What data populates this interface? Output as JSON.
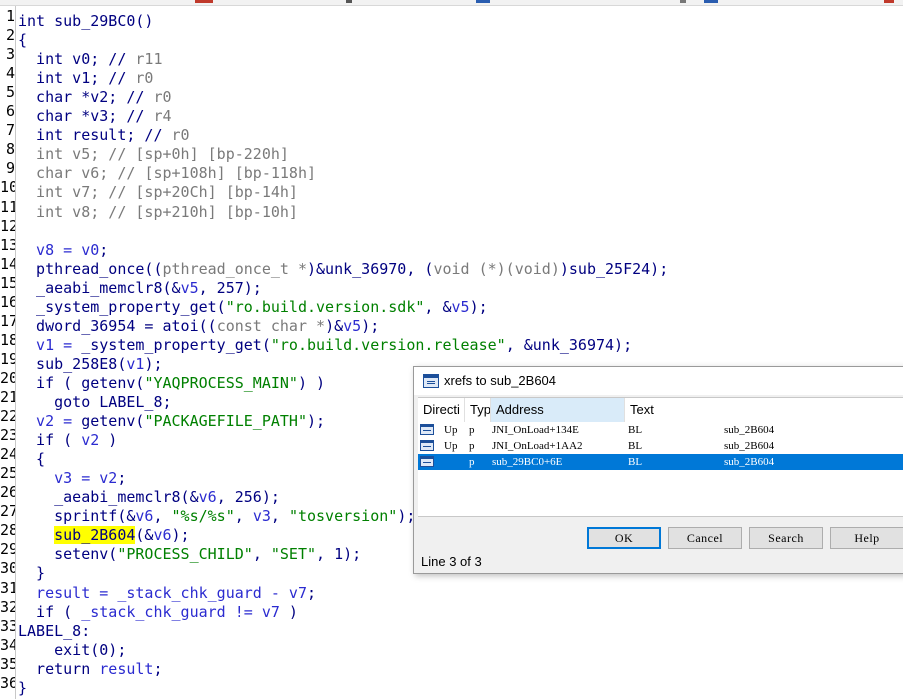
{
  "colors": {
    "selection": "#0078d7",
    "highlight": "#ffff00",
    "keyword": "#000080",
    "variable": "#2b2bd0",
    "comment": "#7a7a7a",
    "string": "#008000"
  },
  "code_lines": [
    {
      "n": "1",
      "tokens": [
        {
          "t": "int sub_29BC0()",
          "c": "kw"
        }
      ]
    },
    {
      "n": "2",
      "tokens": [
        {
          "t": "{",
          "c": "kw"
        }
      ]
    },
    {
      "n": "3",
      "tokens": [
        {
          "t": "  int v0; // ",
          "c": "kw"
        },
        {
          "t": "r11",
          "c": "cmt"
        }
      ]
    },
    {
      "n": "4",
      "tokens": [
        {
          "t": "  int v1; // ",
          "c": "kw"
        },
        {
          "t": "r0",
          "c": "cmt"
        }
      ]
    },
    {
      "n": "5",
      "tokens": [
        {
          "t": "  char *v2; // ",
          "c": "kw"
        },
        {
          "t": "r0",
          "c": "cmt"
        }
      ]
    },
    {
      "n": "6",
      "tokens": [
        {
          "t": "  char *v3; // ",
          "c": "kw"
        },
        {
          "t": "r4",
          "c": "cmt"
        }
      ]
    },
    {
      "n": "7",
      "tokens": [
        {
          "t": "  int result; // ",
          "c": "kw"
        },
        {
          "t": "r0",
          "c": "cmt"
        }
      ]
    },
    {
      "n": "8",
      "tokens": [
        {
          "t": "  int v5; // ",
          "c": "cmt"
        },
        {
          "t": "[sp+0h] [bp-220h]",
          "c": "cmt"
        }
      ]
    },
    {
      "n": "9",
      "tokens": [
        {
          "t": "  char v6; // ",
          "c": "cmt"
        },
        {
          "t": "[sp+108h] [bp-118h]",
          "c": "cmt"
        }
      ]
    },
    {
      "n": "10",
      "tokens": [
        {
          "t": "  int v7; // ",
          "c": "cmt"
        },
        {
          "t": "[sp+20Ch] [bp-14h]",
          "c": "cmt"
        }
      ]
    },
    {
      "n": "11",
      "tokens": [
        {
          "t": "  int v8; // ",
          "c": "cmt"
        },
        {
          "t": "[sp+210h] [bp-10h]",
          "c": "cmt"
        }
      ]
    },
    {
      "n": "12",
      "tokens": []
    },
    {
      "n": "13",
      "tokens": [
        {
          "t": "  v8 = ",
          "c": "var"
        },
        {
          "t": "v0",
          "c": "var"
        },
        {
          "t": ";",
          "c": "kw"
        }
      ]
    },
    {
      "n": "14",
      "tokens": [
        {
          "t": "  pthread_once((",
          "c": "fn"
        },
        {
          "t": "pthread_once_t *",
          "c": "cmt"
        },
        {
          "t": ")&unk_36970, (",
          "c": "fn"
        },
        {
          "t": "void (*)(void)",
          "c": "cmt"
        },
        {
          "t": ")sub_25F24);",
          "c": "fn"
        }
      ]
    },
    {
      "n": "15",
      "tokens": [
        {
          "t": "  _aeabi_memclr8(&",
          "c": "fn"
        },
        {
          "t": "v5",
          "c": "var"
        },
        {
          "t": ", 257);",
          "c": "fn"
        }
      ]
    },
    {
      "n": "16",
      "tokens": [
        {
          "t": "  _system_property_get(",
          "c": "fn"
        },
        {
          "t": "\"ro.build.version.sdk\"",
          "c": "str"
        },
        {
          "t": ", &",
          "c": "fn"
        },
        {
          "t": "v5",
          "c": "var"
        },
        {
          "t": ");",
          "c": "fn"
        }
      ]
    },
    {
      "n": "17",
      "tokens": [
        {
          "t": "  dword_36954 = atoi((",
          "c": "fn"
        },
        {
          "t": "const char *",
          "c": "cmt"
        },
        {
          "t": ")&",
          "c": "fn"
        },
        {
          "t": "v5",
          "c": "var"
        },
        {
          "t": ");",
          "c": "fn"
        }
      ]
    },
    {
      "n": "18",
      "tokens": [
        {
          "t": "  v1 = ",
          "c": "var"
        },
        {
          "t": "_system_property_get(",
          "c": "fn"
        },
        {
          "t": "\"ro.build.version.release\"",
          "c": "str"
        },
        {
          "t": ", &unk_36974);",
          "c": "fn"
        }
      ]
    },
    {
      "n": "19",
      "tokens": [
        {
          "t": "  sub_258E8(",
          "c": "fn"
        },
        {
          "t": "v1",
          "c": "var"
        },
        {
          "t": ");",
          "c": "fn"
        }
      ]
    },
    {
      "n": "20",
      "tokens": [
        {
          "t": "  if ( getenv(",
          "c": "kw"
        },
        {
          "t": "\"YAQPROCESS_MAIN\"",
          "c": "str"
        },
        {
          "t": ") )",
          "c": "kw"
        }
      ]
    },
    {
      "n": "21",
      "tokens": [
        {
          "t": "    goto LABEL_8;",
          "c": "kw"
        }
      ]
    },
    {
      "n": "22",
      "tokens": [
        {
          "t": "  v2 = ",
          "c": "var"
        },
        {
          "t": "getenv(",
          "c": "fn"
        },
        {
          "t": "\"PACKAGEFILE_PATH\"",
          "c": "str"
        },
        {
          "t": ");",
          "c": "fn"
        }
      ]
    },
    {
      "n": "23",
      "tokens": [
        {
          "t": "  if ( ",
          "c": "kw"
        },
        {
          "t": "v2",
          "c": "var"
        },
        {
          "t": " )",
          "c": "kw"
        }
      ]
    },
    {
      "n": "24",
      "tokens": [
        {
          "t": "  {",
          "c": "kw"
        }
      ]
    },
    {
      "n": "25",
      "tokens": [
        {
          "t": "    v3 = v2",
          "c": "var"
        },
        {
          "t": ";",
          "c": "kw"
        }
      ]
    },
    {
      "n": "26",
      "tokens": [
        {
          "t": "    _aeabi_memclr8(&",
          "c": "fn"
        },
        {
          "t": "v6",
          "c": "var"
        },
        {
          "t": ", 256);",
          "c": "fn"
        }
      ]
    },
    {
      "n": "27",
      "tokens": [
        {
          "t": "    sprintf(&",
          "c": "fn"
        },
        {
          "t": "v6",
          "c": "var"
        },
        {
          "t": ", ",
          "c": "fn"
        },
        {
          "t": "\"%s/%s\"",
          "c": "str"
        },
        {
          "t": ", ",
          "c": "fn"
        },
        {
          "t": "v3",
          "c": "var"
        },
        {
          "t": ", ",
          "c": "fn"
        },
        {
          "t": "\"tosversion\"",
          "c": "str"
        },
        {
          "t": ");",
          "c": "fn"
        }
      ]
    },
    {
      "n": "28",
      "tokens": [
        {
          "t": "    ",
          "c": "kw"
        },
        {
          "t": "sub_2B604",
          "c": "hl"
        },
        {
          "t": "(&",
          "c": "fn"
        },
        {
          "t": "v6",
          "c": "var"
        },
        {
          "t": ");",
          "c": "fn"
        }
      ]
    },
    {
      "n": "29",
      "tokens": [
        {
          "t": "    setenv(",
          "c": "fn"
        },
        {
          "t": "\"PROCESS_CHILD\"",
          "c": "str"
        },
        {
          "t": ", ",
          "c": "fn"
        },
        {
          "t": "\"SET\"",
          "c": "str"
        },
        {
          "t": ", 1);",
          "c": "fn"
        }
      ]
    },
    {
      "n": "30",
      "tokens": [
        {
          "t": "  }",
          "c": "kw"
        }
      ]
    },
    {
      "n": "31",
      "tokens": [
        {
          "t": "  result = _stack_chk_guard - v7",
          "c": "var"
        },
        {
          "t": ";",
          "c": "kw"
        }
      ]
    },
    {
      "n": "32",
      "tokens": [
        {
          "t": "  if ( ",
          "c": "kw"
        },
        {
          "t": "_stack_chk_guard != v7",
          "c": "var"
        },
        {
          "t": " )",
          "c": "kw"
        }
      ]
    },
    {
      "n": "33",
      "tokens": [
        {
          "t": "LABEL_8:",
          "c": "kw"
        }
      ]
    },
    {
      "n": "34",
      "tokens": [
        {
          "t": "    exit(0);",
          "c": "fn"
        }
      ]
    },
    {
      "n": "35",
      "tokens": [
        {
          "t": "  return ",
          "c": "kw"
        },
        {
          "t": "result",
          "c": "var"
        },
        {
          "t": ";",
          "c": "kw"
        }
      ]
    },
    {
      "n": "36",
      "tokens": [
        {
          "t": "}",
          "c": "kw"
        }
      ]
    }
  ],
  "dialog": {
    "title": "xrefs to sub_2B604",
    "columns": [
      "Directi",
      "Typ",
      "Address",
      "Text"
    ],
    "rows": [
      {
        "direction": "Up",
        "type": "p",
        "address": "JNI_OnLoad+134E",
        "text": "BL",
        "target": "sub_2B604",
        "selected": false
      },
      {
        "direction": "Up",
        "type": "p",
        "address": "JNI_OnLoad+1AA2",
        "text": "BL",
        "target": "sub_2B604",
        "selected": false
      },
      {
        "direction": "",
        "type": "p",
        "address": "sub_29BC0+6E",
        "text": "BL",
        "target": "sub_2B604",
        "selected": true
      }
    ],
    "buttons": {
      "ok": "OK",
      "cancel": "Cancel",
      "search": "Search",
      "help": "Help"
    },
    "status": "Line 3 of 3"
  }
}
